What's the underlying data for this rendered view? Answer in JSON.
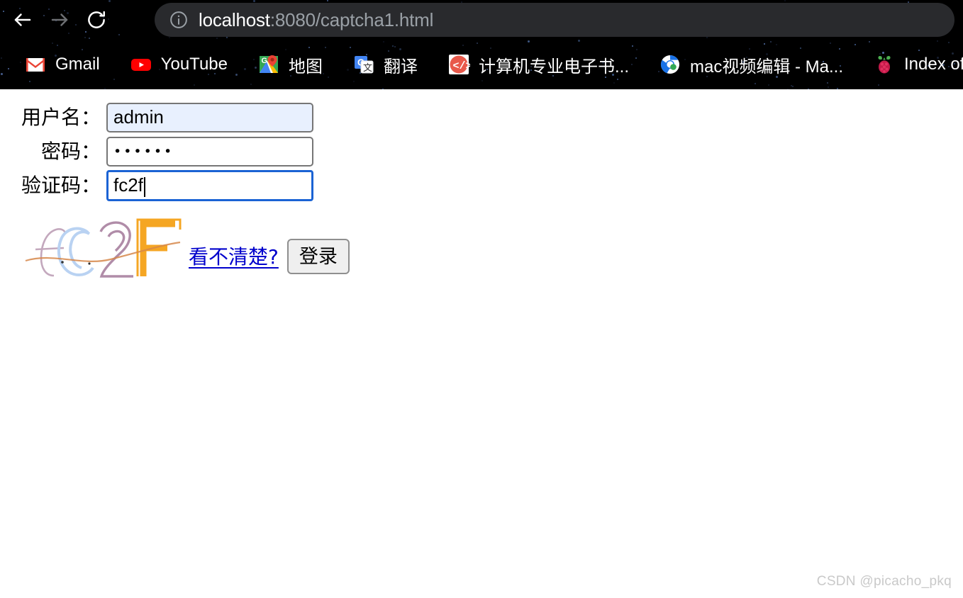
{
  "browser": {
    "nav": {
      "back_icon": "arrow-left-icon",
      "forward_icon": "arrow-right-icon",
      "reload_icon": "reload-icon"
    },
    "omnibox": {
      "info_icon": "info-circle-icon",
      "host": "localhost",
      "path": ":8080/captcha1.html",
      "full_url": "localhost:8080/captcha1.html"
    },
    "bookmarks": [
      {
        "label": "Gmail",
        "icon": "gmail-icon"
      },
      {
        "label": "YouTube",
        "icon": "youtube-icon"
      },
      {
        "label": "地图",
        "icon": "google-maps-icon"
      },
      {
        "label": "翻译",
        "icon": "google-translate-icon"
      },
      {
        "label": "计算机专业电子书...",
        "icon": "code-circle-icon"
      },
      {
        "label": "mac视频编辑 - Ma...",
        "icon": "chrome-circle-icon"
      },
      {
        "label": "Index of /r",
        "icon": "raspberry-pi-icon"
      }
    ]
  },
  "page": {
    "form": {
      "rows": [
        {
          "label": "用户名：",
          "value": "admin",
          "name": "username"
        },
        {
          "label": "密码：",
          "value": "••••••",
          "name": "password"
        },
        {
          "label": "验证码：",
          "value": "fc2f",
          "name": "captcha"
        }
      ],
      "captcha_text": "fc2F",
      "refresh_link": "看不清楚?",
      "submit_label": "登录"
    },
    "watermark": "CSDN @picacho_pkq"
  },
  "colors": {
    "chrome_bg": "#000000",
    "omnibox_bg": "#292a2d",
    "autofill_bg": "#e8f0fe",
    "focus_border": "#1b63d4",
    "link": "#0000cc",
    "button_bg": "#efefef"
  }
}
